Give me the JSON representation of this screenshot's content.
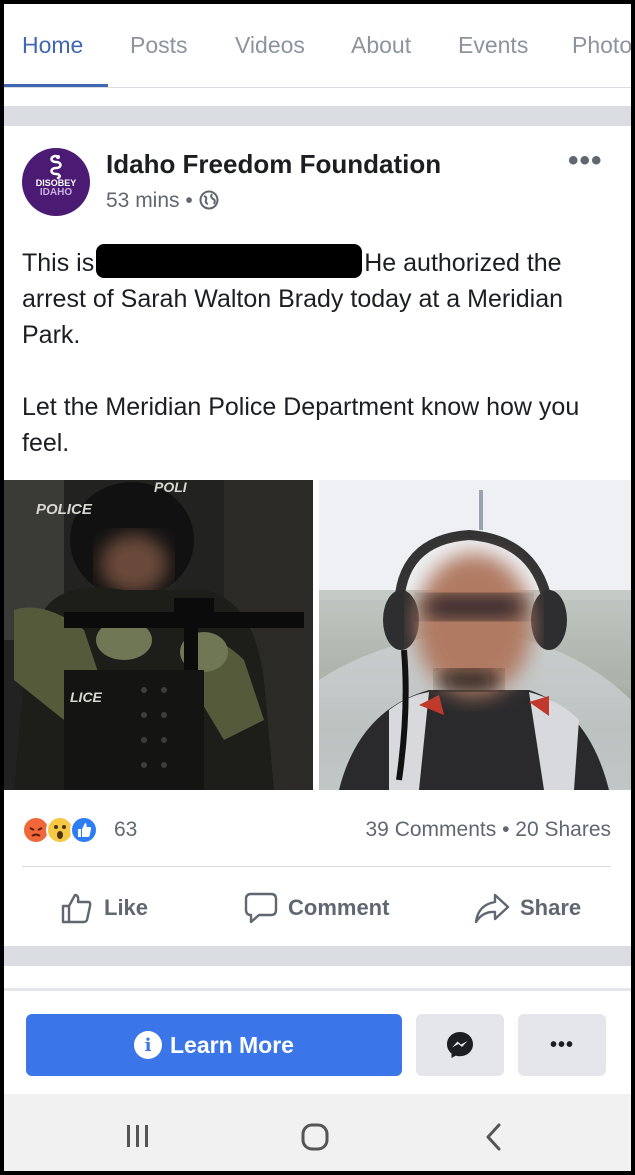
{
  "tabs": [
    "Home",
    "Posts",
    "Videos",
    "About",
    "Events",
    "Photos"
  ],
  "active_tab": "Home",
  "post": {
    "page_name": "Idaho Freedom Foundation",
    "time": "53 mins",
    "meta_separator": "•",
    "avatar": {
      "line1": "DISOBEY",
      "line2": "IDAHO"
    },
    "text_before_redaction": "This is",
    "text_after_redaction": "He authorized the arrest of Sarah Walton Brady today at a Meridian Park.",
    "text_paragraph2": "Let the Meridian Police Department know how you feel.",
    "image_left_text": {
      "top_left": "POLICE",
      "top_center": "POLI",
      "vest": "LICE"
    },
    "reaction_icons": [
      "angry-icon",
      "wow-icon",
      "like-icon"
    ],
    "reaction_count": "63",
    "comments": "39 Comments",
    "shares": "20 Shares",
    "stats_separator": "•"
  },
  "actions": {
    "like": "Like",
    "comment": "Comment",
    "share": "Share"
  },
  "cta": {
    "learn_more": "Learn More",
    "more_dots": "•••"
  },
  "colors": {
    "accent": "#4267b2",
    "button_blue": "#3b76e8",
    "angry": "#f0673a",
    "wow": "#f7c844",
    "like": "#2d7ef4"
  }
}
